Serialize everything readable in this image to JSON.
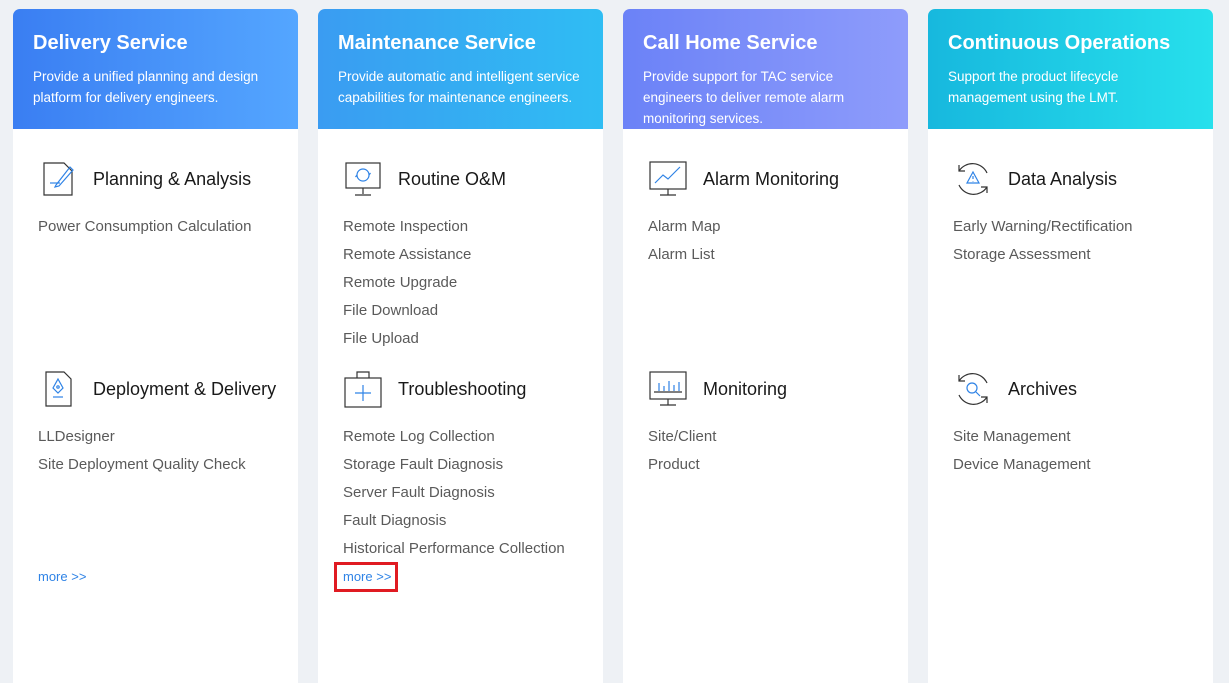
{
  "cards": [
    {
      "title": "Delivery Service",
      "desc": "Provide a unified planning and design platform for delivery engineers.",
      "gradient": [
        "#3a7ef2",
        "#54a6ff"
      ],
      "sections": [
        {
          "title": "Planning & Analysis",
          "icon": "pen-document-icon",
          "items": [
            "Power Consumption Calculation"
          ]
        },
        {
          "title": "Deployment & Delivery",
          "icon": "pen-nib-document-icon",
          "items": [
            "LLDesigner",
            "Site Deployment Quality Check"
          ]
        }
      ],
      "more": "more >>"
    },
    {
      "title": "Maintenance Service",
      "desc": "Provide automatic and intelligent service capabilities for maintenance engineers.",
      "gradient": [
        "#3a9cf2",
        "#2fbdf3"
      ],
      "sections": [
        {
          "title": "Routine O&M",
          "icon": "monitor-cycle-icon",
          "items": [
            "Remote Inspection",
            "Remote Assistance",
            "Remote Upgrade",
            "File Download",
            "File Upload"
          ]
        },
        {
          "title": "Troubleshooting",
          "icon": "medical-kit-icon",
          "items": [
            "Remote Log Collection",
            "Storage Fault Diagnosis",
            "Server Fault Diagnosis",
            "Fault Diagnosis",
            "Historical Performance Collection"
          ]
        }
      ],
      "more": "more >>"
    },
    {
      "title": "Call Home Service",
      "desc": "Provide support for TAC service engineers to deliver remote alarm monitoring services.",
      "gradient": [
        "#6b82f7",
        "#8e9cfb"
      ],
      "sections": [
        {
          "title": "Alarm Monitoring",
          "icon": "monitor-line-chart-icon",
          "items": [
            "Alarm Map",
            "Alarm List"
          ]
        },
        {
          "title": "Monitoring",
          "icon": "monitor-bar-chart-icon",
          "items": [
            "Site/Client",
            "Product"
          ]
        }
      ],
      "more": ""
    },
    {
      "title": "Continuous Operations",
      "desc": "Support the product lifecycle management using the LMT.",
      "gradient": [
        "#17b8de",
        "#27e0ec"
      ],
      "sections": [
        {
          "title": "Data Analysis",
          "icon": "warning-cycle-icon",
          "items": [
            "Early Warning/Rectification",
            "Storage Assessment"
          ]
        },
        {
          "title": "Archives",
          "icon": "search-cycle-icon",
          "items": [
            "Site Management",
            "Device Management"
          ]
        }
      ],
      "more": ""
    }
  ]
}
